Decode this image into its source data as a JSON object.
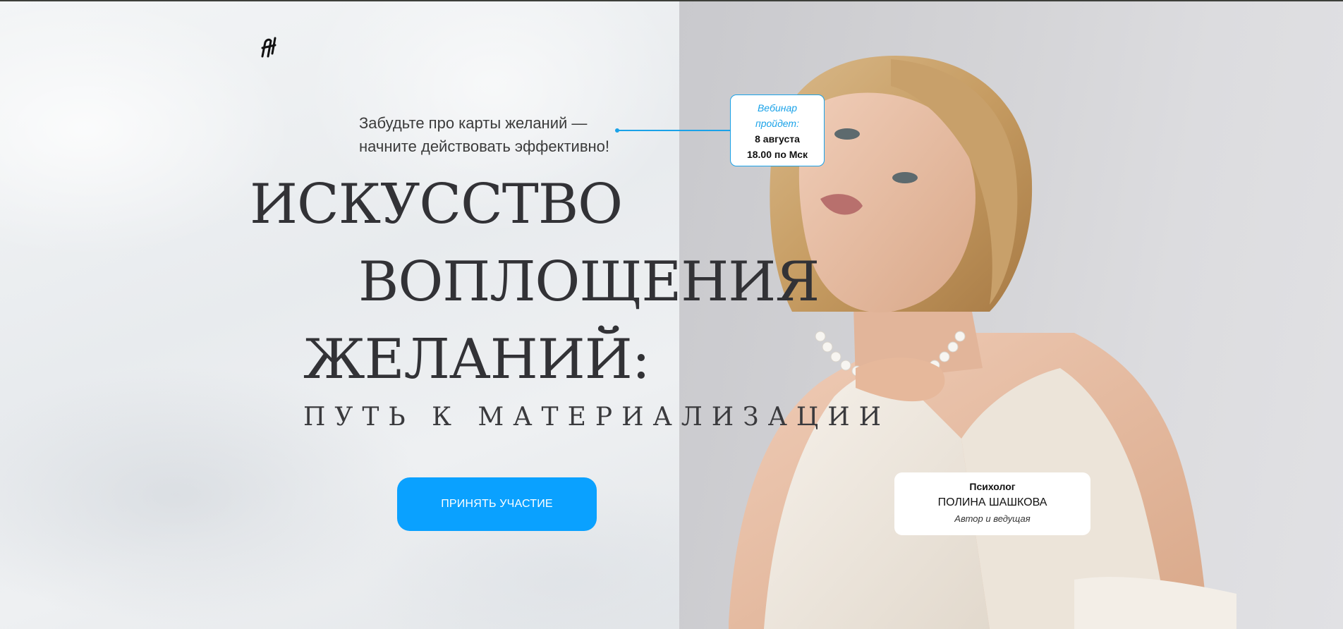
{
  "logo": {
    "icon": "monogram-logo-icon"
  },
  "tagline": {
    "line1": "Забудьте про карты желаний —",
    "line2": "начните действовать эффективно!"
  },
  "webinar": {
    "label_line1": "Вебинар",
    "label_line2": "пройдет:",
    "date": "8 августа",
    "time": "18.00 по Мск"
  },
  "title": {
    "line1": "ИСКУССТВО",
    "line2": "ВОПЛОЩЕНИЯ",
    "line3": "ЖЕЛАНИЙ:"
  },
  "subtitle": "ПУТЬ К МАТЕРИАЛИЗАЦИИ",
  "cta": {
    "label": "ПРИНЯТЬ УЧАСТИЕ"
  },
  "author": {
    "role": "Психолог",
    "name": "ПОЛИНА ШАШКОВА",
    "description": "Автор и ведущая"
  },
  "colors": {
    "accent": "#0aa1ff",
    "title": "#323236",
    "left_bg": "#eef1f3",
    "photo_bg": "#d3d3d6"
  }
}
